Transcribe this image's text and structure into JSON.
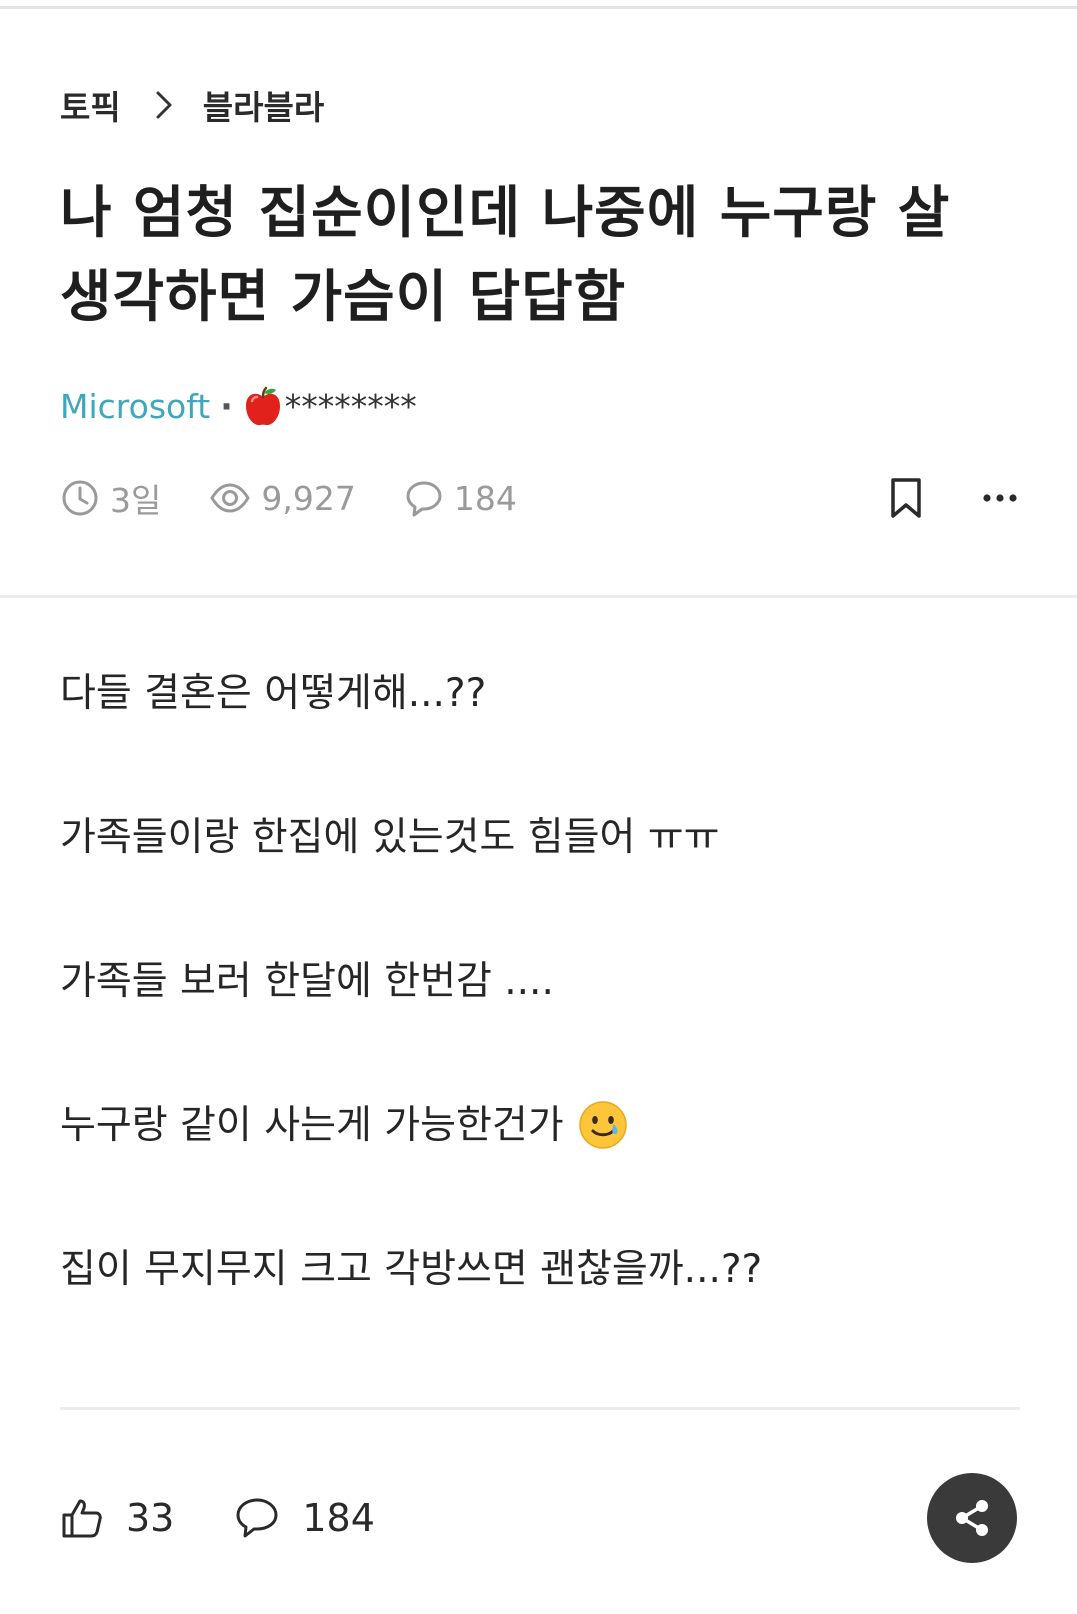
{
  "breadcrumb": {
    "topic": "토픽",
    "board": "블라블라"
  },
  "post": {
    "title": "나 엄청 집순이인데 나중에 누구랑 살 생각하면 가슴이 답답함",
    "company": "Microsoft",
    "separator": "·",
    "nickname": "********",
    "nickname_icon": "apple-icon",
    "time_ago": "3일",
    "views": "9,927",
    "comment_count": "184",
    "body": [
      "다들 결혼은 어떻게해...??",
      "가족들이랑 한집에 있는것도 힘들어 ㅠㅠ",
      "가족들 보러 한달에 한번감 ....",
      "누구랑 같이 사는게 가능한건가",
      "집이 무지무지 크고 각방쓰면 괜찮을까...??"
    ],
    "body_emoji": "smiling-face-with-tear-icon"
  },
  "footer": {
    "likes": "33",
    "comments": "184"
  },
  "colors": {
    "company": "#3fa7bc",
    "meta_gray": "#9a9a9a",
    "share_button": "#3a3a3a"
  }
}
